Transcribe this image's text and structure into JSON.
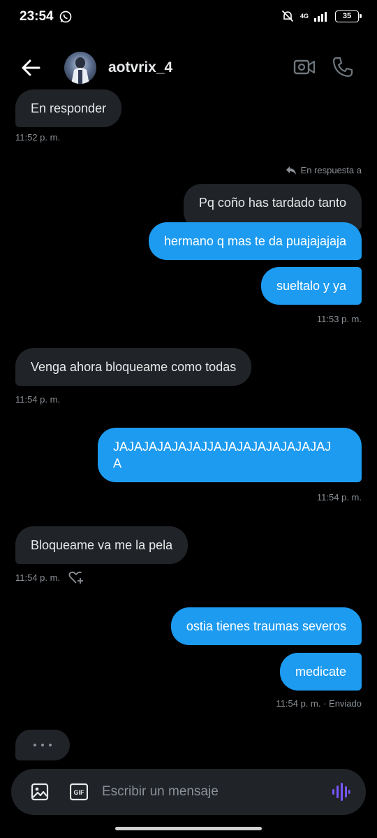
{
  "status": {
    "time": "23:54",
    "network": "4G",
    "battery": "35"
  },
  "header": {
    "username": "aotvrix_4"
  },
  "messages": {
    "m1": "En responder",
    "t1": "11:52 p. m.",
    "reply_label": "En respuesta a",
    "quote": "Pq coño has tardado tanto",
    "m2": "hermano q mas te da puajajajaja",
    "m3": "sueltalo y ya",
    "t2": "11:53 p. m.",
    "m4": "Venga ahora bloqueame como todas",
    "t3": "11:54 p. m.",
    "m5_line1": "JAJAJAJAJAJAJJAJAJAJAJAJAJAJAJ",
    "m5_line2": "A",
    "t4": "11:54 p. m.",
    "m6": "Bloqueame va me la pela",
    "t5": "11:54 p. m.",
    "m7": "ostia tienes traumas severos",
    "m8": "medicate",
    "t6": "11:54 p. m. · Enviado"
  },
  "composer": {
    "placeholder": "Escribir un mensaje",
    "gif_label": "GIF"
  },
  "colors": {
    "accent": "#1d9bf0",
    "bubble_received": "#202327",
    "voice": "#7856ff"
  },
  "icons": [
    "whatsapp-icon",
    "mute-icon",
    "signal-icon",
    "back-arrow-icon",
    "video-icon",
    "phone-icon",
    "reply-icon",
    "heart-plus-icon",
    "image-icon",
    "gif-icon",
    "voice-icon"
  ]
}
